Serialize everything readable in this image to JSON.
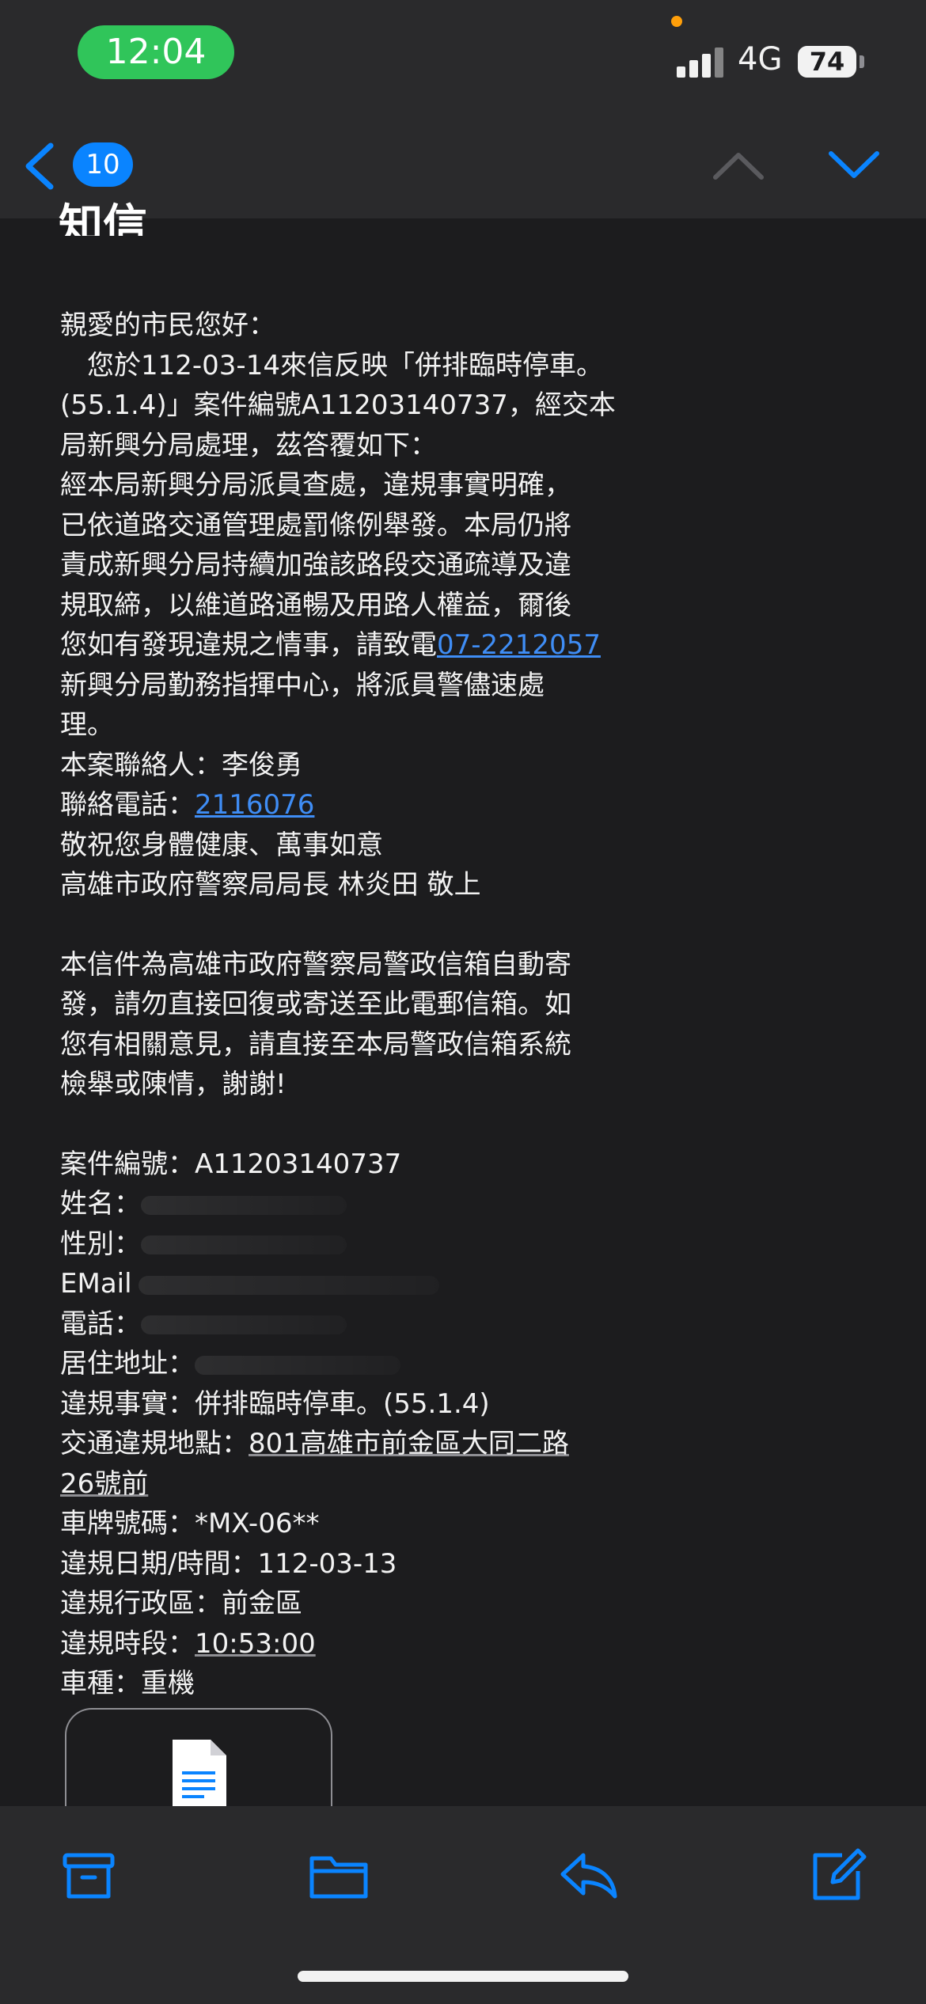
{
  "status_bar": {
    "time": "12:04",
    "network": "4G",
    "battery": "74"
  },
  "nav": {
    "unread_count": "10"
  },
  "mail": {
    "subject": "知信",
    "greeting": "親愛的市民您好：",
    "intro_a": "　您於112-03-14來信反映「併排臨時停車。",
    "intro_b": "(55.1.4)」案件編號A11203140737，經交本",
    "intro_c": "局新興分局處理，茲答覆如下：",
    "body_1": "經本局新興分局派員查處，違規事實明確，",
    "body_2": "已依道路交通管理處罰條例舉發。本局仍將",
    "body_3": "責成新興分局持續加強該路段交通疏導及違",
    "body_4": "規取締，以維道路通暢及用路人權益，爾後",
    "body_5": "您如有發現違規之情事，請致電",
    "phone_link": "07-2212057",
    "body_6": "新興分局勤務指揮中心，將派員警儘速處",
    "body_7": "理。",
    "contact_person": "本案聯絡人：李俊勇",
    "contact_phone_label": "聯絡電話：",
    "contact_phone": "2116076",
    "wish": "敬祝您身體健康、萬事如意",
    "signature": "高雄市政府警察局局長 林炎田 敬上",
    "notice_1": "本信件為高雄市政府警察局警政信箱自動寄",
    "notice_2": "發，請勿直接回復或寄送至此電郵信箱。如",
    "notice_3": "您有相關意見，請直接至本局警政信箱系統",
    "notice_4": "檢舉或陳情，謝謝!",
    "case_no": "案件編號：A11203140737",
    "name_label": "姓名：",
    "gender_label": "性別：",
    "email_label": "EMail",
    "tel_label": "電話：",
    "address_label": "居住地址：",
    "violation_label": "違規事實：併排臨時停車。(55.1.4)",
    "location_label": "交通違規地點：",
    "location_a": "801高雄市前金區大同二路",
    "location_b": "26號前",
    "plate": "車牌號碼：*MX-06**",
    "date_label": "違規日期/時間：112-03-13",
    "district": "違規行政區：前金區",
    "period_label": "違規時段：",
    "period": "10:53:00",
    "vehicle": "車種：重機"
  },
  "toolbar": {
    "icons": [
      "archive-icon",
      "folder-icon",
      "reply-icon",
      "compose-icon"
    ]
  },
  "colors": {
    "accent": "#0a84ff",
    "link": "#3f8df5",
    "background": "#1c1c1e",
    "bars": "#2a2a2c",
    "time_pill": "#30c55a"
  }
}
